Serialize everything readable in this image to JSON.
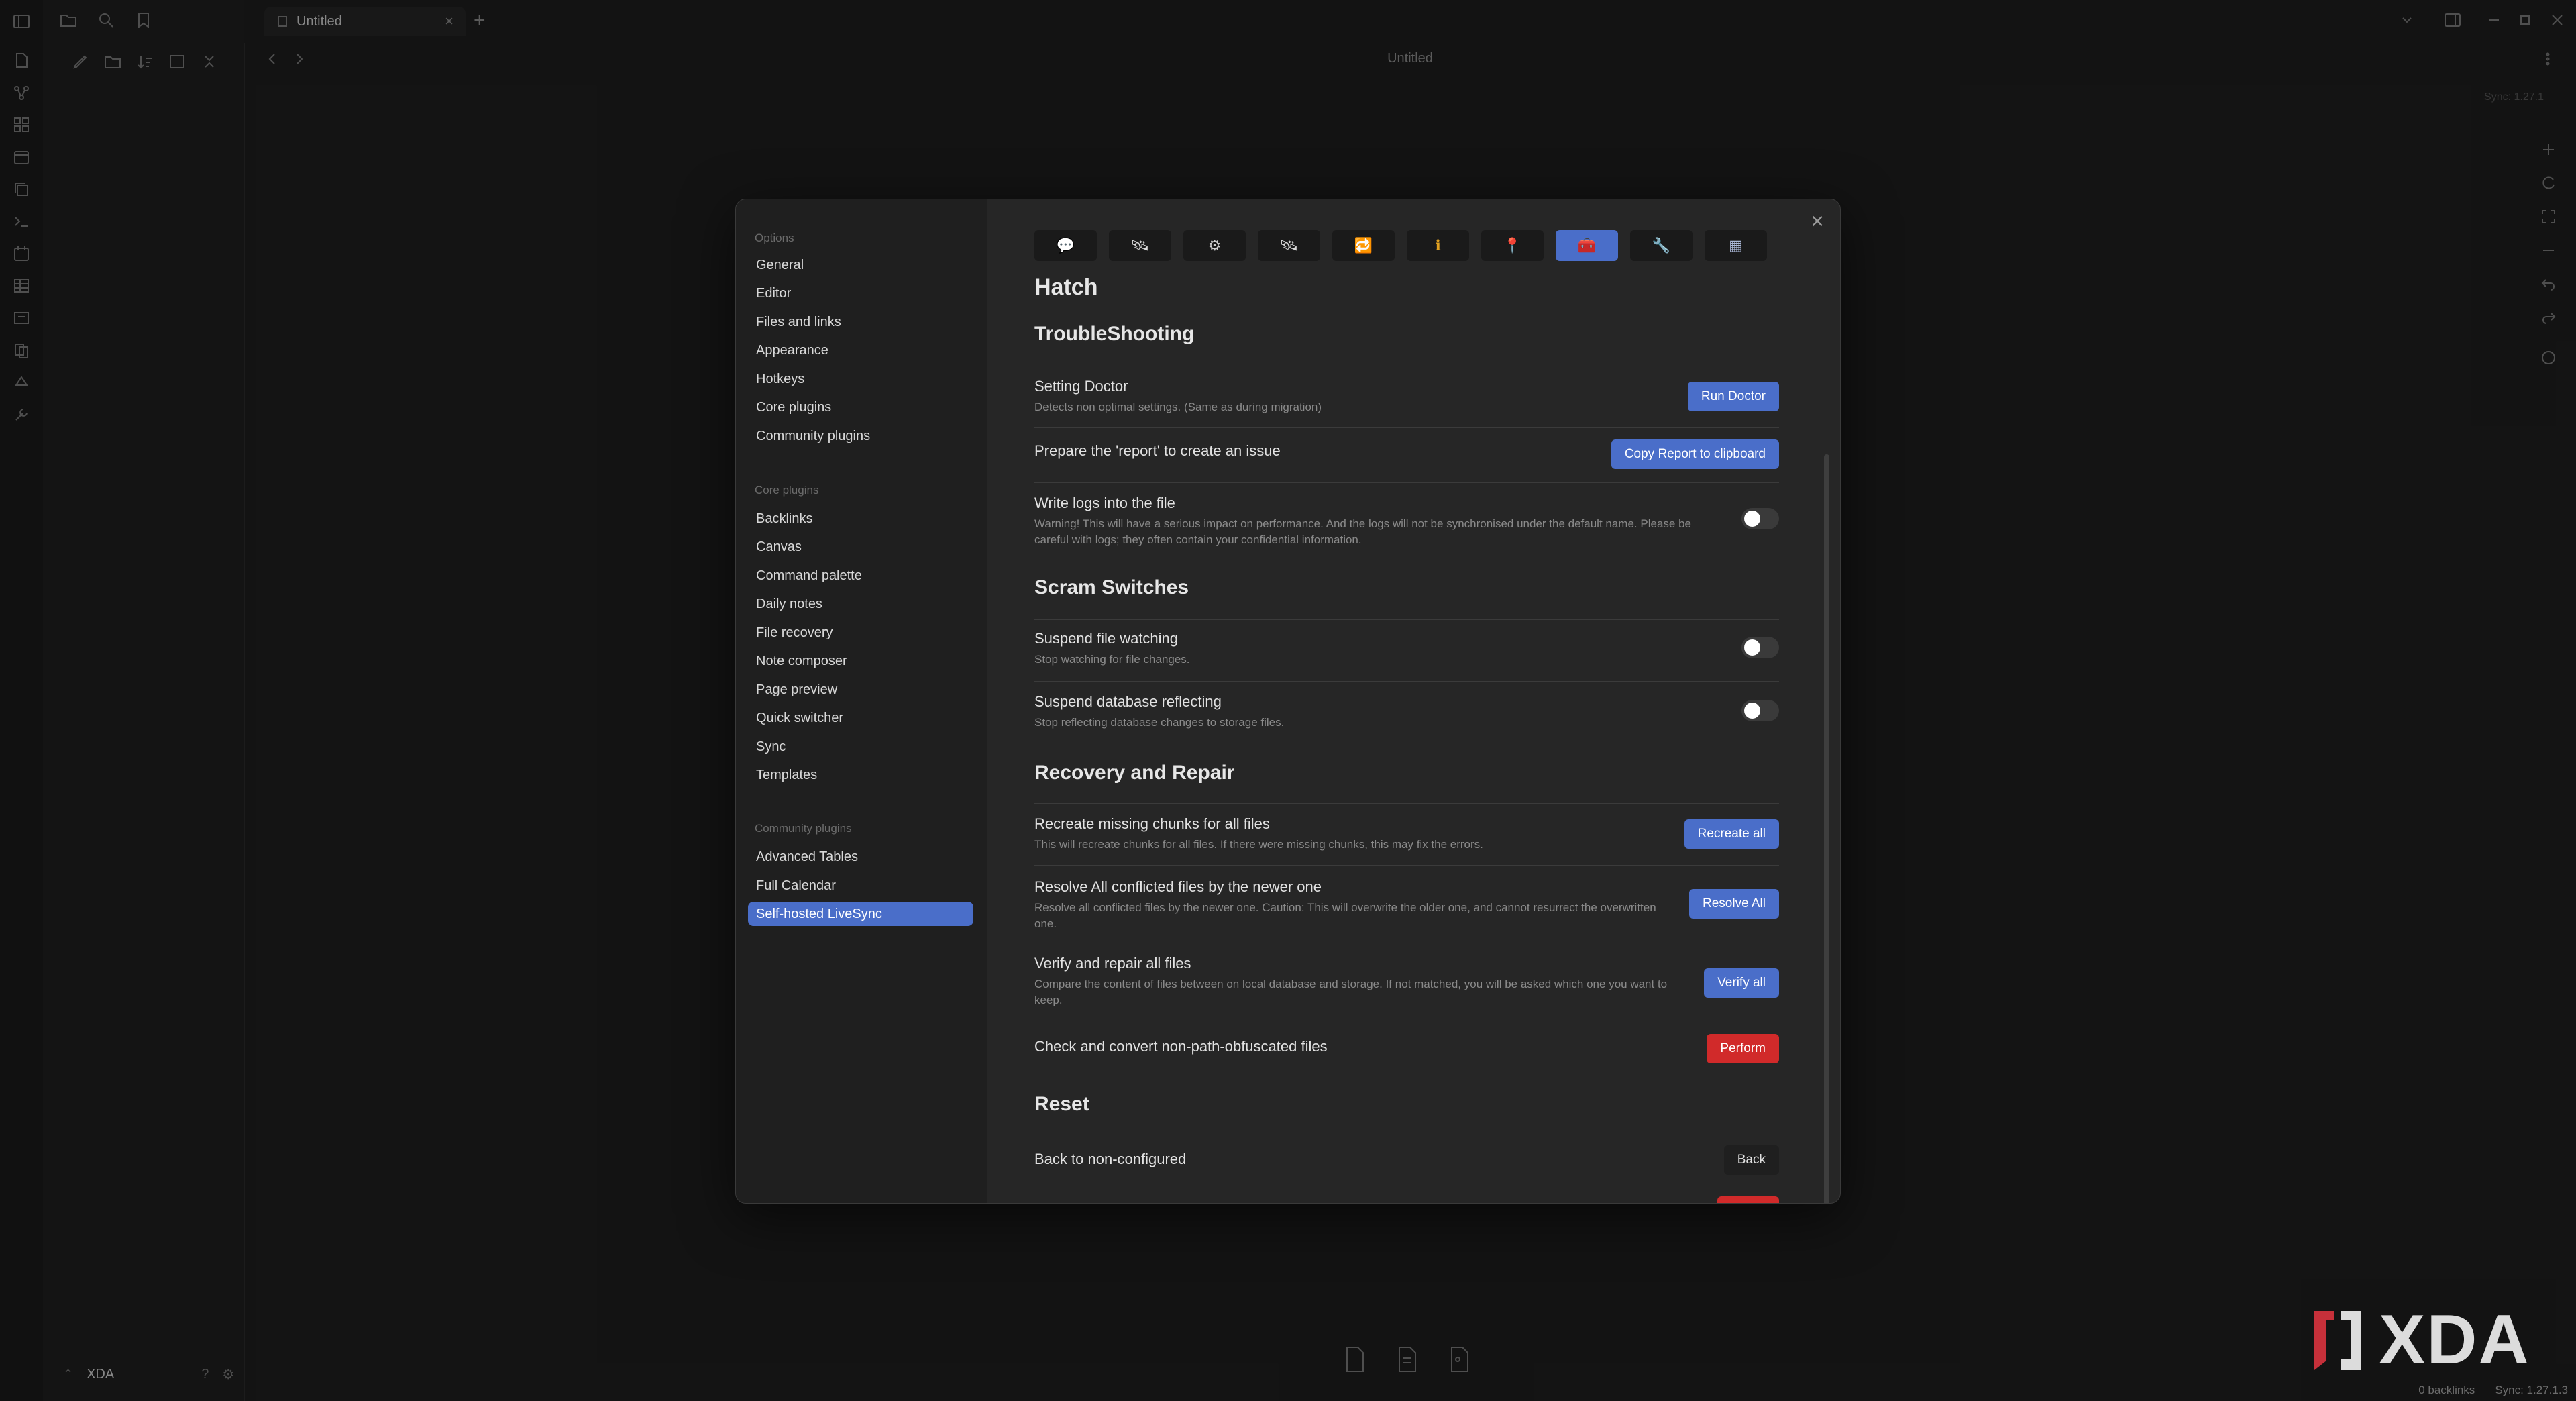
{
  "window": {
    "tab_title": "Untitled",
    "note_title": "Untitled",
    "new_tab": "+",
    "close_tab": "×"
  },
  "vault": {
    "name": "XDA"
  },
  "sync_corner": "Sync: 1.27.1",
  "settings": {
    "close": "×",
    "nav": {
      "options_label": "Options",
      "options": [
        "General",
        "Editor",
        "Files and links",
        "Appearance",
        "Hotkeys",
        "Core plugins",
        "Community plugins"
      ],
      "core_label": "Core plugins",
      "core": [
        "Backlinks",
        "Canvas",
        "Command palette",
        "Daily notes",
        "File recovery",
        "Note composer",
        "Page preview",
        "Quick switcher",
        "Sync",
        "Templates"
      ],
      "community_label": "Community plugins",
      "community": [
        "Advanced Tables",
        "Full Calendar",
        "Self-hosted LiveSync"
      ]
    },
    "icon_tabs": [
      {
        "icon": "speech-balloon-icon",
        "glyph": "💬"
      },
      {
        "icon": "remote-database-icon",
        "glyph": "🛰"
      },
      {
        "icon": "gear-icon",
        "glyph": "⚙"
      },
      {
        "icon": "satellite-icon",
        "glyph": "🛰"
      },
      {
        "icon": "sync-icon",
        "glyph": "🔁"
      },
      {
        "icon": "info-icon",
        "glyph": "ℹ"
      },
      {
        "icon": "pin-icon",
        "glyph": "📍"
      },
      {
        "icon": "toolbox-icon",
        "glyph": "🧰"
      },
      {
        "icon": "wrench-icon",
        "glyph": "🔧"
      },
      {
        "icon": "table-icon",
        "glyph": "▦"
      }
    ],
    "pane_title": "Hatch",
    "troubleshooting": {
      "title": "TroubleShooting",
      "doctor_name": "Setting Doctor",
      "doctor_desc": "Detects non optimal settings. (Same as during migration)",
      "doctor_btn": "Run Doctor",
      "report_name": "Prepare the 'report' to create an issue",
      "report_btn": "Copy Report to clipboard",
      "logs_name": "Write logs into the file",
      "logs_desc": "Warning! This will have a serious impact on performance. And the logs will not be synchronised under the default name. Please be careful with logs; they often contain your confidential information."
    },
    "scram": {
      "title": "Scram Switches",
      "watch_name": "Suspend file watching",
      "watch_desc": "Stop watching for file changes.",
      "db_name": "Suspend database reflecting",
      "db_desc": "Stop reflecting database changes to storage files."
    },
    "recovery": {
      "title": "Recovery and Repair",
      "chunks_name": "Recreate missing chunks for all files",
      "chunks_desc": "This will recreate chunks for all files. If there were missing chunks, this may fix the errors.",
      "chunks_btn": "Recreate all",
      "conflict_name": "Resolve All conflicted files by the newer one",
      "conflict_desc": "Resolve all conflicted files by the newer one. Caution: This will overwrite the older one, and cannot resurrect the overwritten one.",
      "conflict_btn": "Resolve All",
      "verify_name": "Verify and repair all files",
      "verify_desc": "Compare the content of files between on local database and storage. If not matched, you will be asked which one you want to keep.",
      "verify_btn": "Verify all",
      "convert_name": "Check and convert non-path-obfuscated files",
      "convert_btn": "Perform"
    },
    "reset": {
      "title": "Reset",
      "back_name": "Back to non-configured",
      "back_btn": "Back"
    }
  },
  "watermark": "XDA",
  "status": {
    "backlinks": "0 backlinks",
    "sync": "Sync: 1.27.1.3"
  },
  "colors": {
    "accent": "#4a6ec9",
    "danger": "#d12a2a",
    "modal_bg": "#262626"
  }
}
